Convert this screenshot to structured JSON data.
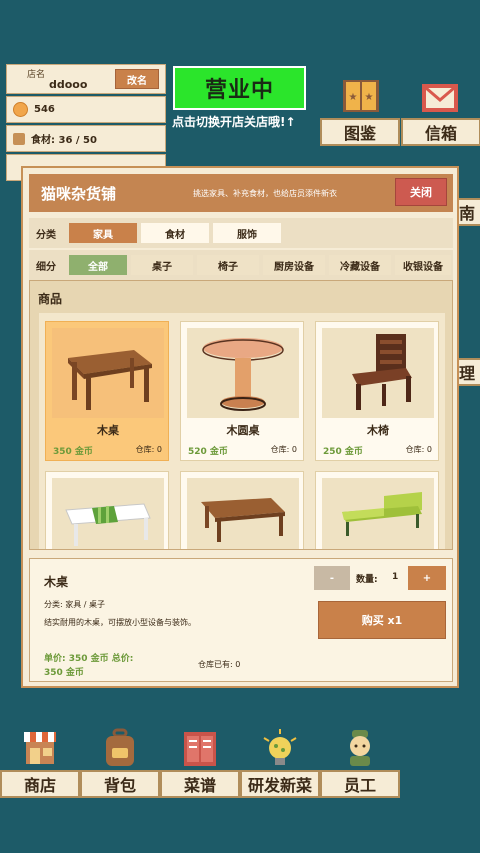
{
  "store_info": {
    "name_label": "店名",
    "name_value": "ddooo",
    "rename_label": "改名",
    "coins": "546",
    "ingredients_label": "食材: 36 / 50"
  },
  "status": {
    "open_label": "营业中",
    "hint": "点击切换开店关店哦!↑"
  },
  "top_buttons": {
    "collection": "图鉴",
    "mailbox": "信箱",
    "peek_right_1": "南",
    "peek_right_2": "理"
  },
  "shop": {
    "title": "猫咪杂货铺",
    "subtitle": "挑选家具、补充食材，也给店员添件新衣",
    "close_label": "关闭",
    "category_label": "分类",
    "categories": [
      "家具",
      "食材",
      "服饰"
    ],
    "subcategory_label": "细分",
    "subcategories": [
      "全部",
      "桌子",
      "椅子",
      "厨房设备",
      "冷藏设备",
      "收银设备"
    ],
    "products_heading": "商品",
    "products": [
      {
        "name": "木桌",
        "price": "350 金币",
        "stock": "仓库: 0"
      },
      {
        "name": "木圆桌",
        "price": "520 金币",
        "stock": "仓库: 0"
      },
      {
        "name": "木椅",
        "price": "250 金币",
        "stock": "仓库: 0"
      },
      {
        "name": "",
        "price": "",
        "stock": ""
      },
      {
        "name": "",
        "price": "",
        "stock": ""
      },
      {
        "name": "",
        "price": "",
        "stock": ""
      }
    ],
    "detail": {
      "name": "木桌",
      "category": "分类: 家具 / 桌子",
      "description": "结实耐用的木桌，可摆放小型设备与装饰。",
      "price_line": "单价: 350 金币    总价:",
      "total_value": "350 金币",
      "owned": "仓库已有: 0",
      "minus": "-",
      "qty_label": "数量:",
      "qty_value": "1",
      "plus": "+",
      "buy_label": "购买 x1"
    }
  },
  "bottom_nav": {
    "shop": "商店",
    "backpack": "背包",
    "recipes": "菜谱",
    "develop": "研发新菜",
    "staff": "员工"
  },
  "colors": {
    "background": "#1d5b68",
    "accent": "#c9814a",
    "status_green": "#2be52b",
    "close_red": "#cd5a50",
    "price_green": "#6d9a3a",
    "selected_card": "#fbc87a"
  }
}
